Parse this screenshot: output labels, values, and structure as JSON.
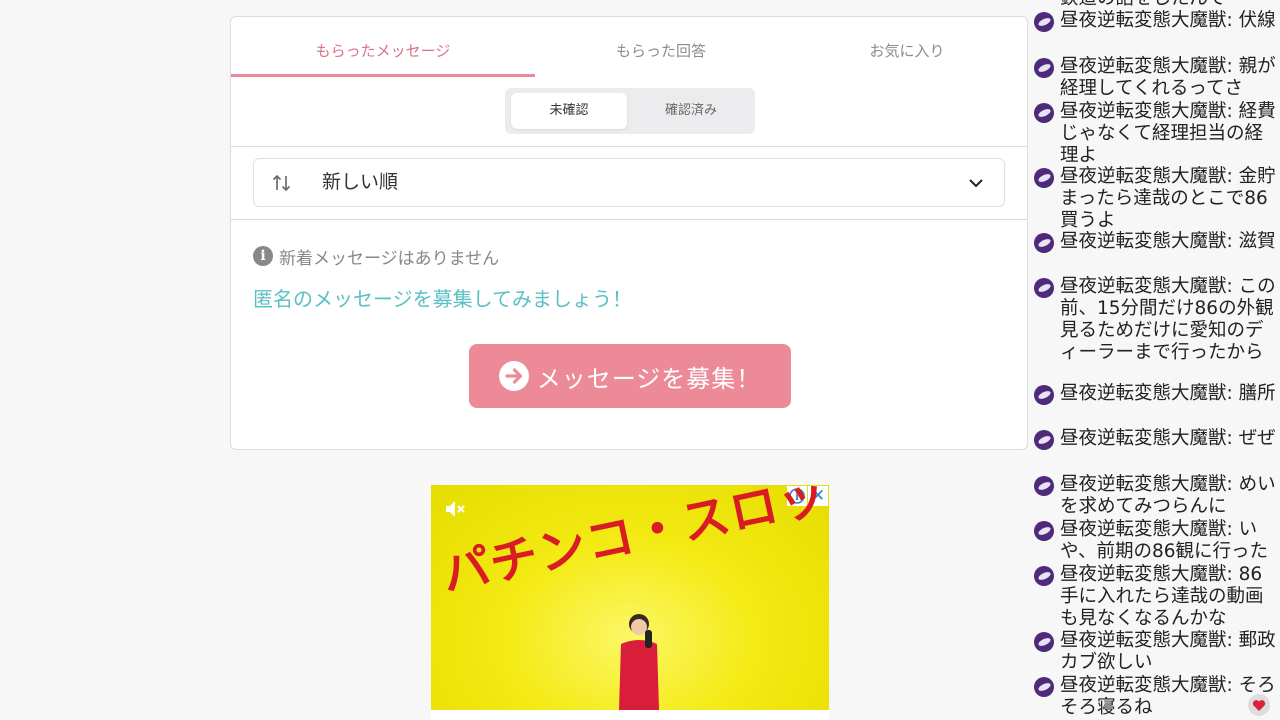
{
  "tabs": [
    {
      "label": "もらったメッセージ",
      "active": true
    },
    {
      "label": "もらった回答",
      "active": false
    },
    {
      "label": "お気に入り",
      "active": false
    }
  ],
  "segments": [
    {
      "label": "未確認",
      "active": true
    },
    {
      "label": "確認済み",
      "active": false
    }
  ],
  "sort": {
    "label": "新しい順"
  },
  "info": {
    "text": "新着メッセージはありません"
  },
  "recruit": {
    "link_text": "匿名のメッセージを募集してみましょう！",
    "button_label": "メッセージを募集！"
  },
  "ad": {
    "headline": "パチンコ・スロット",
    "close": "✕",
    "choices": "i"
  },
  "chat": {
    "partial_top": "鉄道の話をしたんで",
    "messages": [
      {
        "user": "昼夜逆転変態大魔獣",
        "text": "伏線"
      },
      {
        "user": "昼夜逆転変態大魔獣",
        "text": "親が経理してくれるってさ"
      },
      {
        "user": "昼夜逆転変態大魔獣",
        "text": "経費じゃなくて経理担当の経理よ"
      },
      {
        "user": "昼夜逆転変態大魔獣",
        "text": "金貯まったら達哉のとこで86買うよ"
      },
      {
        "user": "昼夜逆転変態大魔獣",
        "text": "滋賀"
      },
      {
        "user": "昼夜逆転変態大魔獣",
        "text": "この前、15分間だけ86の外観見るためだけに愛知のディーラーまで行ったから"
      },
      {
        "user": "昼夜逆転変態大魔獣",
        "text": "膳所"
      },
      {
        "user": "昼夜逆転変態大魔獣",
        "text": "ぜぜ"
      },
      {
        "user": "昼夜逆転変態大魔獣",
        "text": "めいを求めてみつらんに"
      },
      {
        "user": "昼夜逆転変態大魔獣",
        "text": "いや、前期の86観に行った"
      },
      {
        "user": "昼夜逆転変態大魔獣",
        "text": "86手に入れたら達哉の動画も見なくなるんかな"
      },
      {
        "user": "昼夜逆転変態大魔獣",
        "text": "郵政カブ欲しい"
      },
      {
        "user": "昼夜逆転変態大魔獣",
        "text": "そろそろ寝るね"
      }
    ]
  },
  "colors": {
    "accent_pink": "#e06f86",
    "button_pink": "#ec8a98",
    "link_teal": "#5bc0c5",
    "ad_yellow": "#f4ea14",
    "ad_red": "#d91c24",
    "avatar_purple": "#4e2a7a"
  },
  "icons": {
    "sort": "sort-arrows-icon",
    "dropdown": "chevron-down-icon",
    "info": "info-icon",
    "button": "arrow-circle-right-icon",
    "mute": "mute-icon",
    "heart": "heart-icon"
  }
}
